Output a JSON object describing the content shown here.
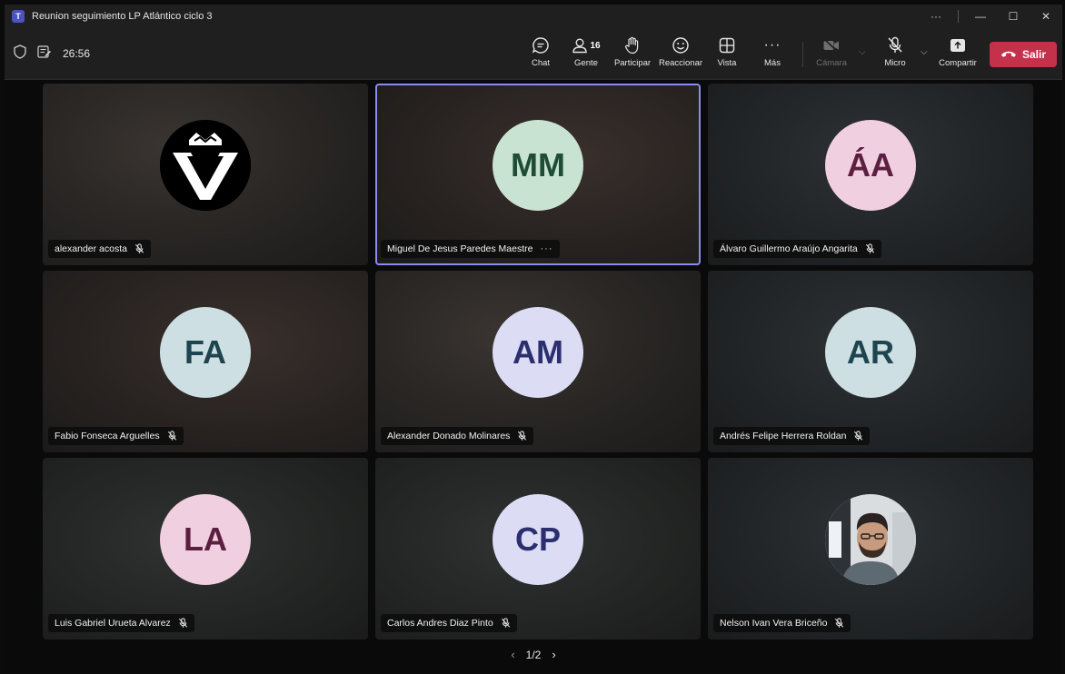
{
  "window": {
    "title": "Reunion seguimiento LP Atlántico ciclo 3",
    "app_icon": "teams-icon"
  },
  "toolbar": {
    "timer": "26:56",
    "buttons": {
      "chat": "Chat",
      "people": "Gente",
      "people_count": "16",
      "raise": "Participar",
      "react": "Reaccionar",
      "view": "Vista",
      "more": "Más",
      "camera": "Cámara",
      "mic": "Micro",
      "share": "Compartir",
      "leave": "Salir"
    }
  },
  "participants": [
    {
      "name": "alexander acosta",
      "avatar_type": "logo",
      "muted": true
    },
    {
      "name": "Miguel De Jesus Paredes Maestre",
      "initials": "MM",
      "avatar_bg": "#c9e3d2",
      "avatar_fg": "#1f4d33",
      "active": true,
      "more": "···"
    },
    {
      "name": "Álvaro Guillermo Araújo Angarita",
      "initials": "ÁA",
      "avatar_bg": "#f0cfe0",
      "avatar_fg": "#5c1f3f",
      "muted": true
    },
    {
      "name": "Fabio Fonseca Arguelles",
      "initials": "FA",
      "avatar_bg": "#cddfe3",
      "avatar_fg": "#1e4450",
      "muted": true
    },
    {
      "name": "Alexander Donado Molinares",
      "initials": "AM",
      "avatar_bg": "#dcdcf5",
      "avatar_fg": "#2c2f6e",
      "muted": true
    },
    {
      "name": "Andrés Felipe Herrera Roldan",
      "initials": "AR",
      "avatar_bg": "#cddfe3",
      "avatar_fg": "#1e4450",
      "muted": true
    },
    {
      "name": "Luis Gabriel Urueta Alvarez",
      "initials": "LA",
      "avatar_bg": "#f0cfe0",
      "avatar_fg": "#5c1f3f",
      "muted": true
    },
    {
      "name": "Carlos Andres Diaz Pinto",
      "initials": "CP",
      "avatar_bg": "#dcdcf5",
      "avatar_fg": "#2c2f6e",
      "muted": true
    },
    {
      "name": "Nelson Ivan Vera Briceño",
      "avatar_type": "photo",
      "muted": true
    }
  ],
  "pager": {
    "label": "1/2"
  },
  "colors": {
    "leave": "#c4314b",
    "active_outline": "#8b8cf0"
  }
}
